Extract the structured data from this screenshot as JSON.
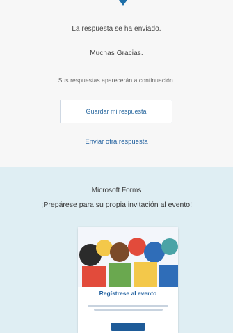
{
  "page": {
    "message": "La respuesta se ha enviado.",
    "thanks": "Muchas Gracias.",
    "info": "Sus respuestas aparecerán a continuación.",
    "save_button": "Guardar mi respuesta",
    "send_link": "Enviar otra respuesta"
  },
  "promo": {
    "brand": "Microsoft Forms",
    "headline": "¡Prepárese para su propia invitación al evento!",
    "card_title": "Regístrese al evento"
  },
  "colors": {
    "accent": "#1f5f9e",
    "promo_bg": "#dfeef3"
  },
  "icons": [
    "arrow-down-icon"
  ]
}
